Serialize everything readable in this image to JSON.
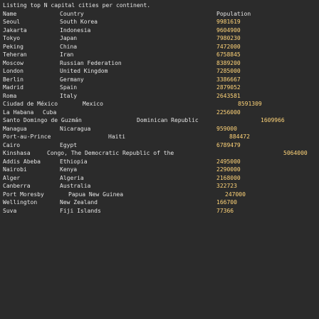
{
  "terminal": {
    "title_line": "Listing top N capital cities per continent.",
    "headers": [
      "Name",
      "Country",
      "Population"
    ],
    "rows": [
      [
        "Seoul",
        "South Korea",
        "9981619"
      ],
      [
        "Jakarta",
        "Indonesia",
        "9604900"
      ],
      [
        "Tokyo",
        "Japan",
        "7980230"
      ],
      [
        "Peking",
        "China",
        "7472000"
      ],
      [
        "Teheran",
        "Iran",
        "6758845"
      ],
      [
        "Moscow",
        "Russian Federation",
        "8389200"
      ],
      [
        "London",
        "United Kingdom",
        "7285000"
      ],
      [
        "Berlin",
        "Germany",
        "3386667"
      ],
      [
        "Madrid",
        "Spain",
        "2879052"
      ],
      [
        "Roma",
        "Italy",
        "2643581"
      ],
      [
        "Ciudad de México",
        "Mexico",
        "8591309"
      ],
      [
        "La Habana",
        "Cuba",
        "2256000"
      ],
      [
        "Santo Domingo de Guzmán",
        "Dominican Republic",
        "1609966"
      ],
      [
        "Managua",
        "Nicaragua",
        "959000"
      ],
      [
        "Port-au-Prince",
        "Haiti",
        "884472"
      ],
      [
        "Cairo",
        "Egypt",
        "6789479"
      ],
      [
        "Kinshasa",
        "Congo, The Democratic Republic of the",
        "5064000"
      ],
      [
        "Addis Abeba",
        "Ethiopia",
        "2495000"
      ],
      [
        "Nairobi",
        "Kenya",
        "2290000"
      ],
      [
        "Alger",
        "Algeria",
        "2168000"
      ],
      [
        "Canberra",
        "Australia",
        "322723"
      ],
      [
        "Port Moresby",
        "Papua New Guinea",
        "247000"
      ],
      [
        "Wellington",
        "New Zealand",
        "166700"
      ],
      [
        "Suva",
        "Fiji Islands",
        "77366"
      ]
    ]
  }
}
